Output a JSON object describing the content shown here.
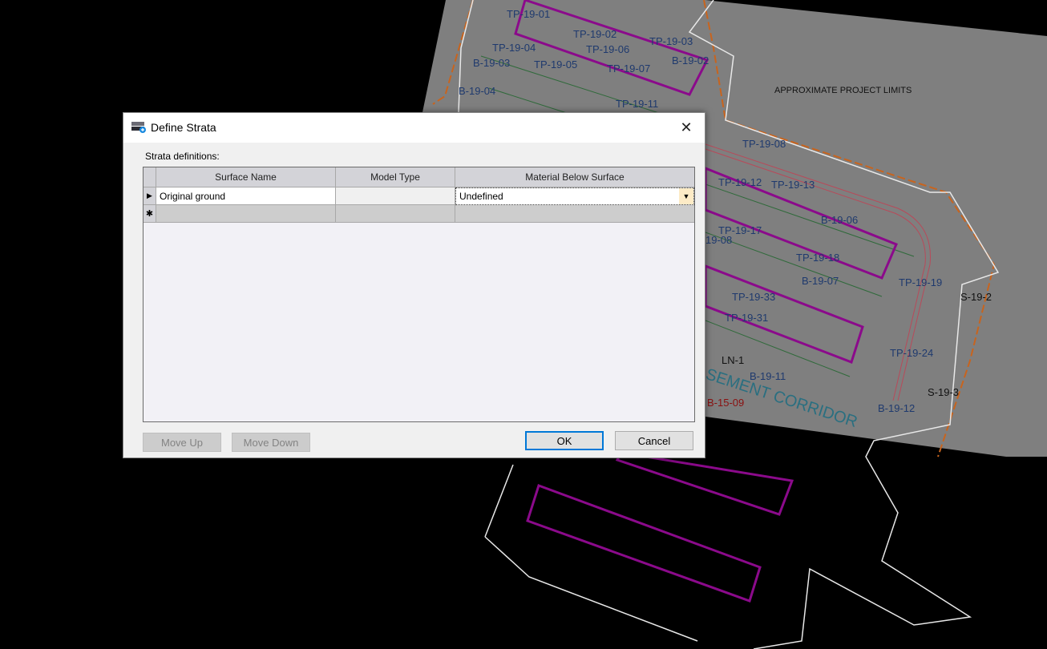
{
  "background": {
    "labels": [
      "TP-19-01",
      "TP-19-02",
      "TP-19-03",
      "TP-19-04",
      "TP-19-06",
      "B-19-03",
      "TP-19-05",
      "B-19-02",
      "TP-19-07",
      "B-19-04",
      "TP-19-11",
      "APPROXIMATE PROJECT LIMITS",
      "TP-19-08",
      "TP-19-12",
      "TP-19-13",
      "B-19-06",
      "TP-19-17",
      "19-08",
      "TP-19-18",
      "B-19-07",
      "TP-19-33",
      "TP-19-31",
      "TP-19-19",
      "S-19-2",
      "TP-19-24",
      "LN-1",
      "B-19-11",
      "B-15-09",
      "S-19-3",
      "B-19-12",
      "EASEMENT CORRIDOR"
    ]
  },
  "dialog": {
    "title": "Define Strata",
    "close_icon": "close-icon",
    "strata_label": "Strata definitions:",
    "columns": [
      "Surface Name",
      "Model Type",
      "Material Below Surface"
    ],
    "rows": [
      {
        "indicator": "▶",
        "surface_name": "Original ground",
        "model_type": "",
        "material": "Undefined"
      },
      {
        "indicator": "✱",
        "surface_name": "",
        "model_type": "",
        "material": ""
      }
    ],
    "buttons": {
      "move_up": "Move Up",
      "move_down": "Move Down",
      "ok": "OK",
      "cancel": "Cancel"
    }
  }
}
